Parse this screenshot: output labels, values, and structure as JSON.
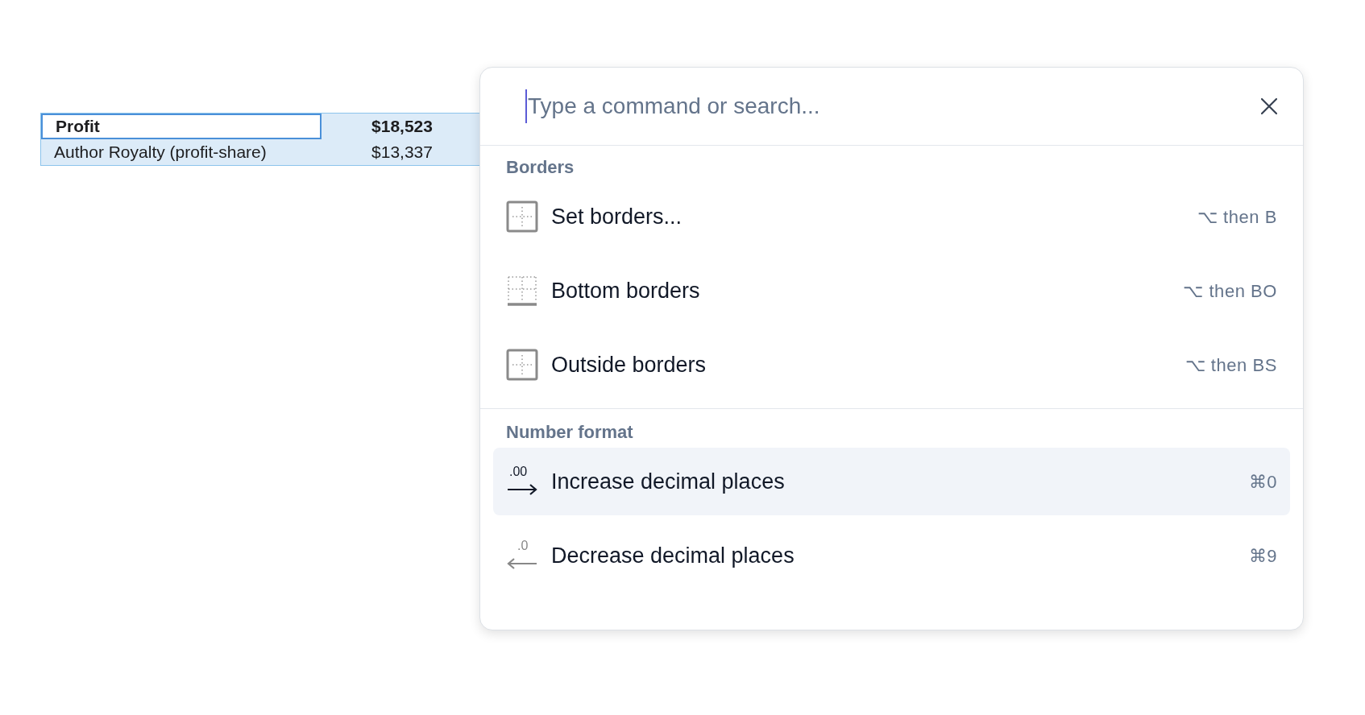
{
  "sheet": {
    "rows": [
      {
        "label": "Profit",
        "value": "$18,523",
        "bold": true,
        "selected": true
      },
      {
        "label": "Author Royalty (profit-share)",
        "value": "$13,337",
        "bold": false,
        "selected": false
      }
    ]
  },
  "palette": {
    "search": {
      "placeholder": "Type a command or search..."
    },
    "groups": [
      {
        "title": "Borders",
        "items": [
          {
            "kind": "set-borders",
            "label": "Set borders...",
            "shortcut": "⌥ then B",
            "selected": false
          },
          {
            "kind": "bottom-borders",
            "label": "Bottom borders",
            "shortcut": "⌥ then BO",
            "selected": false
          },
          {
            "kind": "outside-borders",
            "label": "Outside borders",
            "shortcut": "⌥ then BS",
            "selected": false
          }
        ]
      },
      {
        "title": "Number format",
        "items": [
          {
            "kind": "increase-decimal",
            "icon_text": ".00",
            "label": "Increase decimal places",
            "shortcut": "⌘0",
            "selected": true
          },
          {
            "kind": "decrease-decimal",
            "icon_text": ".0",
            "label": "Decrease decimal places",
            "shortcut": "⌘9",
            "selected": false
          }
        ]
      }
    ]
  }
}
